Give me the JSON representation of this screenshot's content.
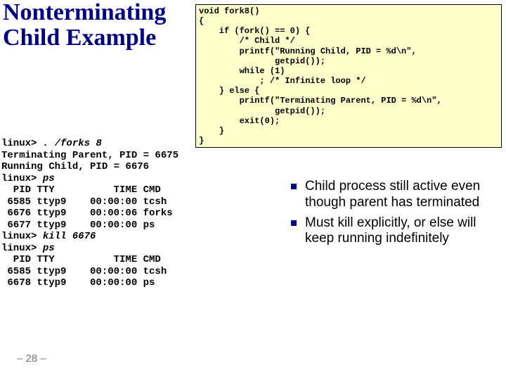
{
  "title": "Nonterminating Child Example",
  "code": "void fork8()\n{\n    if (fork() == 0) {\n        /* Child */\n        printf(\"Running Child, PID = %d\\n\",\n               getpid());\n        while (1)\n            ; /* Infinite loop */\n    } else {\n        printf(\"Terminating Parent, PID = %d\\n\",\n               getpid());\n        exit(0);\n    }\n}",
  "terminal": {
    "line0_prompt": "linux> ",
    "line0_cmd": ". /forks 8",
    "line1": "Terminating Parent, PID = 6675",
    "line2": "Running Child, PID = 6676",
    "line3_prompt": "linux> ",
    "line3_cmd": "ps",
    "line4": "  PID TTY          TIME CMD",
    "line5": " 6585 ttyp9    00:00:00 tcsh",
    "line6": " 6676 ttyp9    00:00:06 forks",
    "line7": " 6677 ttyp9    00:00:00 ps",
    "line8_prompt": "linux> ",
    "line8_cmd": "kill 6676",
    "line9_prompt": "linux> ",
    "line9_cmd": "ps",
    "line10": "  PID TTY          TIME CMD",
    "line11": " 6585 ttyp9    00:00:00 tcsh",
    "line12": " 6678 ttyp9    00:00:00 ps"
  },
  "bullets": {
    "b1": "Child process still active even though parent has terminated",
    "b2": "Must kill explicitly, or else will keep running indefinitely"
  },
  "pagenum": "– 28 –"
}
